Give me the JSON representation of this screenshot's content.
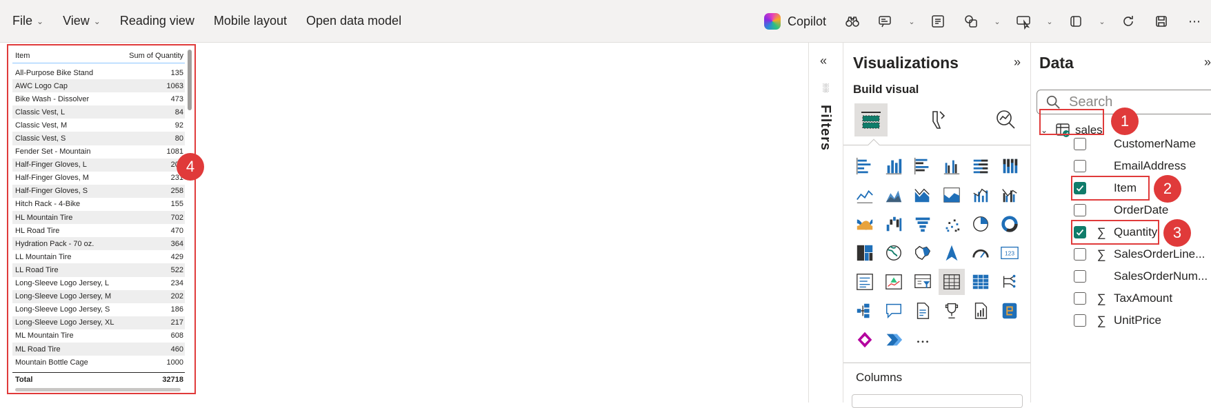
{
  "menubar": {
    "left_items": [
      {
        "label": "File",
        "has_dropdown": true
      },
      {
        "label": "View",
        "has_dropdown": true
      },
      {
        "label": "Reading view",
        "has_dropdown": false
      },
      {
        "label": "Mobile layout",
        "has_dropdown": false
      },
      {
        "label": "Open data model",
        "has_dropdown": false
      }
    ],
    "copilot_label": "Copilot",
    "right_icons": [
      "binoculars-icon",
      "smart-narrative-icon",
      "dropdown-chevron",
      "text-box-icon",
      "shapes-icon",
      "dropdown-chevron",
      "buttons-icon",
      "dropdown-chevron",
      "visual-gallery-icon",
      "dropdown-chevron",
      "refresh-icon",
      "save-icon",
      "more-options-icon"
    ]
  },
  "table_visual": {
    "columns": [
      "Item",
      "Sum of Quantity"
    ],
    "rows": [
      [
        "All-Purpose Bike Stand",
        "135"
      ],
      [
        "AWC Logo Cap",
        "1063"
      ],
      [
        "Bike Wash - Dissolver",
        "473"
      ],
      [
        "Classic Vest, L",
        "84"
      ],
      [
        "Classic Vest, M",
        "92"
      ],
      [
        "Classic Vest, S",
        "80"
      ],
      [
        "Fender Set - Mountain",
        "1081"
      ],
      [
        "Half-Finger Gloves, L",
        "209"
      ],
      [
        "Half-Finger Gloves, M",
        "231"
      ],
      [
        "Half-Finger Gloves, S",
        "258"
      ],
      [
        "Hitch Rack - 4-Bike",
        "155"
      ],
      [
        "HL Mountain Tire",
        "702"
      ],
      [
        "HL Road Tire",
        "470"
      ],
      [
        "Hydration Pack - 70 oz.",
        "364"
      ],
      [
        "LL Mountain Tire",
        "429"
      ],
      [
        "LL Road Tire",
        "522"
      ],
      [
        "Long-Sleeve Logo Jersey, L",
        "234"
      ],
      [
        "Long-Sleeve Logo Jersey, M",
        "202"
      ],
      [
        "Long-Sleeve Logo Jersey, S",
        "186"
      ],
      [
        "Long-Sleeve Logo Jersey, XL",
        "217"
      ],
      [
        "ML Mountain Tire",
        "608"
      ],
      [
        "ML Road Tire",
        "460"
      ],
      [
        "Mountain Bottle Cage",
        "1000"
      ]
    ],
    "total_label": "Total",
    "total_value": "32718",
    "callout": "4"
  },
  "filters": {
    "label": "Filters"
  },
  "visualizations": {
    "title": "Visualizations",
    "build_label": "Build visual",
    "columns_label": "Columns"
  },
  "data_pane": {
    "title": "Data",
    "search_placeholder": "Search",
    "table_name": "sales",
    "fields": [
      {
        "name": "CustomerName",
        "checked": false,
        "sigma": false
      },
      {
        "name": "EmailAddress",
        "checked": false,
        "sigma": false
      },
      {
        "name": "Item",
        "checked": true,
        "sigma": false
      },
      {
        "name": "OrderDate",
        "checked": false,
        "sigma": false
      },
      {
        "name": "Quantity",
        "checked": true,
        "sigma": true
      },
      {
        "name": "SalesOrderLine...",
        "checked": false,
        "sigma": true
      },
      {
        "name": "SalesOrderNum...",
        "checked": false,
        "sigma": false
      },
      {
        "name": "TaxAmount",
        "checked": false,
        "sigma": true
      },
      {
        "name": "UnitPrice",
        "checked": false,
        "sigma": true
      }
    ],
    "callouts": [
      "1",
      "2",
      "3"
    ]
  },
  "colors": {
    "accent_teal": "#107c6a",
    "highlight_red": "#e03a3a",
    "viz_blue": "#1f6fb8"
  }
}
